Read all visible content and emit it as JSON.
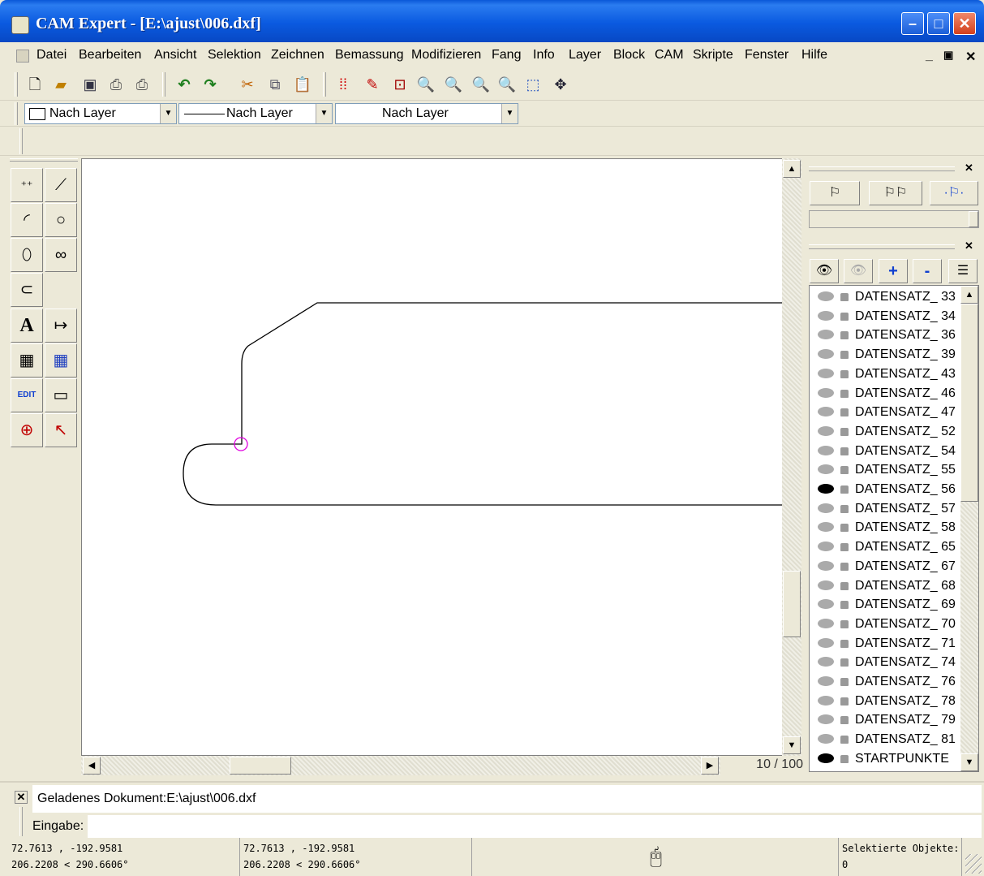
{
  "window": {
    "title": "CAM Expert - [E:\\ajust\\006.dxf]"
  },
  "menu": [
    "Datei",
    "Bearbeiten",
    "Ansicht",
    "Selektion",
    "Zeichnen",
    "Bemassung",
    "Modifizieren",
    "Fang",
    "Info",
    "Layer",
    "Block",
    "CAM",
    "Skripte",
    "Fenster",
    "Hilfe"
  ],
  "props": {
    "color": "Nach Layer",
    "linetype": "Nach Layer",
    "lineweight": "Nach Layer"
  },
  "canvas": {
    "zoom": "10 / 100"
  },
  "layers": [
    {
      "name": "DATENSATZ_ 33",
      "visible": false
    },
    {
      "name": "DATENSATZ_ 34",
      "visible": false
    },
    {
      "name": "DATENSATZ_ 36",
      "visible": false
    },
    {
      "name": "DATENSATZ_ 39",
      "visible": false
    },
    {
      "name": "DATENSATZ_ 43",
      "visible": false
    },
    {
      "name": "DATENSATZ_ 46",
      "visible": false
    },
    {
      "name": "DATENSATZ_ 47",
      "visible": false
    },
    {
      "name": "DATENSATZ_ 52",
      "visible": false
    },
    {
      "name": "DATENSATZ_ 54",
      "visible": false
    },
    {
      "name": "DATENSATZ_ 55",
      "visible": false
    },
    {
      "name": "DATENSATZ_ 56",
      "visible": true
    },
    {
      "name": "DATENSATZ_ 57",
      "visible": false
    },
    {
      "name": "DATENSATZ_ 58",
      "visible": false
    },
    {
      "name": "DATENSATZ_ 65",
      "visible": false
    },
    {
      "name": "DATENSATZ_ 67",
      "visible": false
    },
    {
      "name": "DATENSATZ_ 68",
      "visible": false
    },
    {
      "name": "DATENSATZ_ 69",
      "visible": false
    },
    {
      "name": "DATENSATZ_ 70",
      "visible": false
    },
    {
      "name": "DATENSATZ_ 71",
      "visible": false
    },
    {
      "name": "DATENSATZ_ 74",
      "visible": false
    },
    {
      "name": "DATENSATZ_ 76",
      "visible": false
    },
    {
      "name": "DATENSATZ_ 78",
      "visible": false
    },
    {
      "name": "DATENSATZ_ 79",
      "visible": false
    },
    {
      "name": "DATENSATZ_ 81",
      "visible": false
    },
    {
      "name": "STARTPUNKTE",
      "visible": true
    }
  ],
  "console": {
    "message": "Geladenes Dokument:E:\\ajust\\006.dxf",
    "input_label": "Eingabe:"
  },
  "status": {
    "coord1_line1": "72.7613 , -192.9581",
    "coord1_line2": "206.2208 < 290.6606°",
    "coord2_line1": "72.7613 , -192.9581",
    "coord2_line2": "206.2208 < 290.6606°",
    "selected_label": "Selektierte Objekte:",
    "selected_count": "0"
  }
}
